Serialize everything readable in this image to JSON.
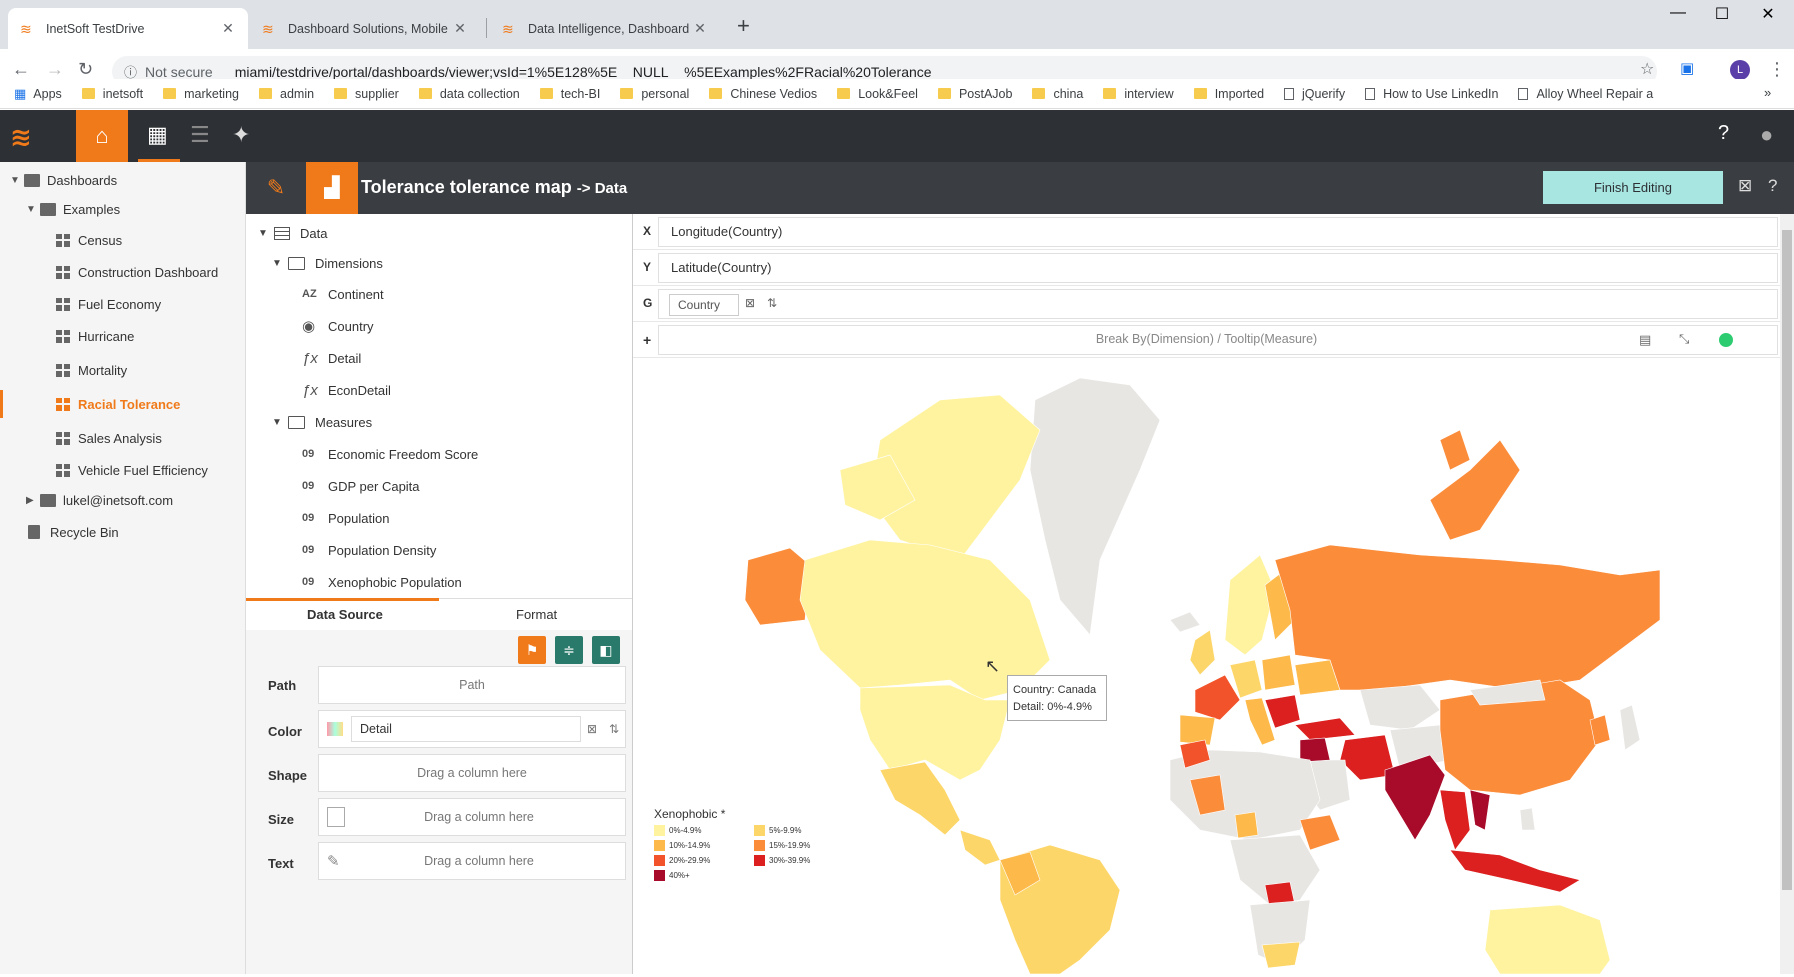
{
  "browser": {
    "tabs": [
      {
        "title": "InetSoft TestDrive"
      },
      {
        "title": "Dashboard Solutions, Mobile BI S"
      },
      {
        "title": "Data Intelligence, Dashboard BI -"
      }
    ],
    "not_secure": "Not secure",
    "url": "miami/testdrive/portal/dashboards/viewer;vsId=1%5E128%5E__NULL__%5EExamples%2FRacial%20Tolerance",
    "bookmarks": [
      "Apps",
      "inetsoft",
      "marketing",
      "admin",
      "supplier",
      "data collection",
      "tech-BI",
      "personal",
      "Chinese Vedios",
      "Look&Feel",
      "PostAJob",
      "china",
      "interview",
      "Imported",
      "jQuerify",
      "How to Use LinkedIn",
      "Alloy Wheel Repair a"
    ]
  },
  "sidebar": {
    "root": "Dashboards",
    "examples": "Examples",
    "items": [
      "Census",
      "Construction Dashboard",
      "Fuel Economy",
      "Hurricane",
      "Mortality",
      "Racial Tolerance",
      "Sales Analysis",
      "Vehicle Fuel Efficiency"
    ],
    "user_folder": "lukel@inetsoft.com",
    "recycle": "Recycle Bin"
  },
  "panel": {
    "title": "Tolerance tolerance map",
    "subtitle": "-> Data",
    "finish": "Finish Editing"
  },
  "datatree": {
    "root": "Data",
    "dimensions": "Dimensions",
    "dim_items": [
      {
        "type": "AZ",
        "label": "Continent"
      },
      {
        "type": "geo",
        "label": "Country"
      },
      {
        "type": "fx",
        "label": "Detail"
      },
      {
        "type": "fx",
        "label": "EconDetail"
      }
    ],
    "measures": "Measures",
    "measure_type": "09",
    "measure_items": [
      "Economic Freedom Score",
      "GDP per Capita",
      "Population",
      "Population Density",
      "Xenophobic Population"
    ]
  },
  "bindtabs": {
    "source": "Data Source",
    "format": "Format"
  },
  "bindfields": {
    "path_label": "Path",
    "path_placeholder": "Path",
    "color_label": "Color",
    "color_value": "Detail",
    "shape_label": "Shape",
    "size_label": "Size",
    "text_label": "Text",
    "drag": "Drag a column here"
  },
  "shelves": {
    "x_axis": "X",
    "x_value": "Longitude(Country)",
    "y_axis": "Y",
    "y_value": "Latitude(Country)",
    "g_axis": "G",
    "g_value": "Country",
    "plus": "+",
    "break_by": "Break By(Dimension) / Tooltip(Measure)"
  },
  "legend": {
    "title": "Xenophobic *",
    "items": [
      {
        "label": "0%-4.9%",
        "color": "#fff3a0"
      },
      {
        "label": "5%-9.9%",
        "color": "#fdd66a"
      },
      {
        "label": "10%-14.9%",
        "color": "#fdb94a"
      },
      {
        "label": "15%-19.9%",
        "color": "#fb8c3a"
      },
      {
        "label": "20%-29.9%",
        "color": "#f2532a"
      },
      {
        "label": "30%-39.9%",
        "color": "#dc1f1f"
      },
      {
        "label": "40%+",
        "color": "#a80a2a"
      }
    ]
  },
  "tooltip": {
    "line1": "Country: Canada",
    "line2": "Detail: 0%-4.9%"
  },
  "colors": {
    "accent": "#f07a1a",
    "header": "#2d3034",
    "finish": "#a8e6e2",
    "nodata": "#e8e6e3"
  }
}
